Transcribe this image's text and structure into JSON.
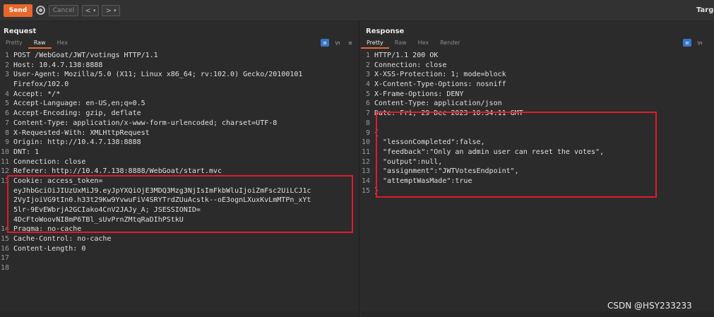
{
  "toolbar": {
    "send_label": "Send",
    "cancel_label": "Cancel",
    "back_label": "<",
    "forward_label": ">",
    "dropdown_label": "▾",
    "target_label": "Targe"
  },
  "request": {
    "title": "Request",
    "tabs": [
      "Pretty",
      "Raw",
      "Hex"
    ],
    "active_tab": "Raw",
    "lines": [
      "POST /WebGoat/JWT/votings HTTP/1.1",
      "Host: 10.4.7.138:8888",
      "User-Agent: Mozilla/5.0 (X11; Linux x86_64; rv:102.0) Gecko/20100101",
      "Firefox/102.0",
      "Accept: */*",
      "Accept-Language: en-US,en;q=0.5",
      "Accept-Encoding: gzip, deflate",
      "Content-Type: application/x-www-form-urlencoded; charset=UTF-8",
      "X-Requested-With: XMLHttpRequest",
      "Origin: http://10.4.7.138:8888",
      "DNT: 1",
      "Connection: close",
      "Referer: http://10.4.7.138:8888/WebGoat/start.mvc",
      "Cookie: access_token=",
      "eyJhbGciOiJIUzUxMiJ9.eyJpYXQiOjE3MDQ3Mzg3NjIsImFkbWluIjoiZmFsc2UiLCJ1c",
      "2VyIjoiVG9tIn0.h33t29Kw9YvwuFiV4SRYTrdZUuAcstk--oE3ognLXuxKvLmMTPn_xYt",
      "5lr-9EvEWbrjA2GCIako4CnV2JAJy_A; JSESSIONID=",
      "4DcFtoWoovNI8mP6TBl_sUvPrnZMtqRaDIhPStkU",
      "Pragma: no-cache",
      "Cache-Control: no-cache",
      "Content-Length: 0",
      "",
      ""
    ],
    "line_numbers": [
      "1",
      "2",
      "3",
      "",
      "4",
      "5",
      "6",
      "7",
      "8",
      "9",
      "10",
      "11",
      "12",
      "13",
      "",
      "",
      "",
      "",
      "14",
      "15",
      "16",
      "17",
      "18"
    ]
  },
  "response": {
    "title": "Response",
    "tabs": [
      "Pretty",
      "Raw",
      "Hex",
      "Render"
    ],
    "active_tab": "Pretty",
    "lines": [
      "HTTP/1.1 200 OK",
      "Connection: close",
      "X-XSS-Protection: 1; mode=block",
      "X-Content-Type-Options: nosniff",
      "X-Frame-Options: DENY",
      "Content-Type: application/json",
      "Date: Fri, 29 Dec 2023 10:34:11 GMT",
      "",
      "{",
      "  \"lessonCompleted\":false,",
      "  \"feedback\":\"Only an admin user can reset the votes\",",
      "  \"output\":null,",
      "  \"assignment\":\"JWTVotesEndpoint\",",
      "  \"attemptWasMade\":true",
      "}"
    ],
    "line_numbers": [
      "1",
      "2",
      "3",
      "4",
      "5",
      "6",
      "7",
      "8",
      "9",
      "10",
      "11",
      "12",
      "13",
      "14",
      "15"
    ]
  },
  "icons": {
    "wrap": "≡",
    "newline": "\\n"
  },
  "watermark": "CSDN @HSY233233",
  "colors": {
    "accent": "#e8672c",
    "highlight_box": "#e01c2c",
    "active_tool": "#3a74c4"
  }
}
